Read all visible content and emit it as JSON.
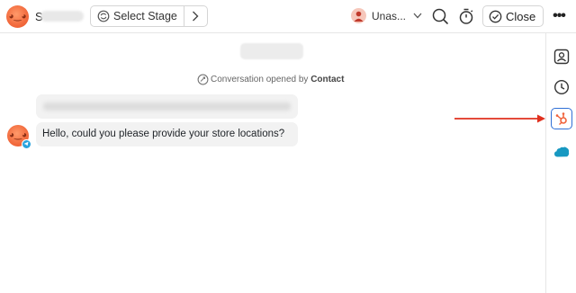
{
  "header": {
    "contact_initial": "S",
    "stage_label": "Select Stage",
    "assignee_label": "Unas...",
    "close_label": "Close",
    "more_label": "•••"
  },
  "conversation": {
    "system_message": {
      "prefix": "Conversation opened by",
      "actor": "Contact"
    },
    "messages": [
      {
        "text": "Hello, could you please provide your store locations?",
        "channel_icon": "telegram-icon"
      }
    ]
  },
  "rail": {
    "items": [
      "contact-icon",
      "history-icon",
      "hubspot-icon",
      "salesforce-icon"
    ],
    "active_item": "hubspot-icon"
  },
  "colors": {
    "accent": "#2f6fd6",
    "annotation_arrow": "#e0301e",
    "avatar": "#f26a3d",
    "telegram": "#2aa3dd",
    "salesforce": "#1798c1",
    "hubspot": "#f0623a"
  }
}
